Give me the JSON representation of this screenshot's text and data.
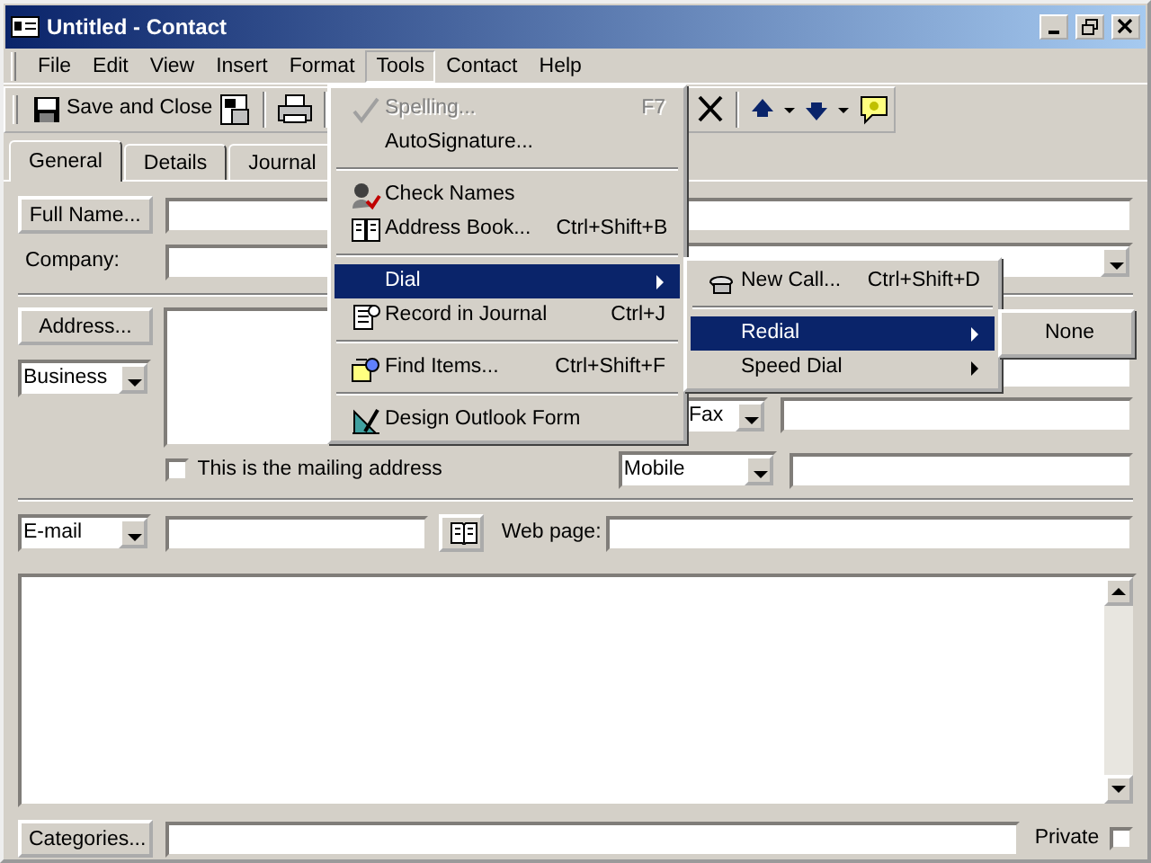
{
  "window": {
    "title": "Untitled - Contact"
  },
  "menu_bar": [
    {
      "label": "File",
      "selected": false
    },
    {
      "label": "Edit",
      "selected": false
    },
    {
      "label": "View",
      "selected": false
    },
    {
      "label": "Insert",
      "selected": false
    },
    {
      "label": "Format",
      "selected": false
    },
    {
      "label": "Tools",
      "selected": true
    },
    {
      "label": "Contact",
      "selected": false
    },
    {
      "label": "Help",
      "selected": false
    }
  ],
  "toolbar": {
    "save_and_close": "Save and Close"
  },
  "tabs": [
    {
      "label": "General",
      "selected": true
    },
    {
      "label": "Details",
      "selected": false
    },
    {
      "label": "Journal",
      "selected": false
    }
  ],
  "form": {
    "full_name_button": "Full Name...",
    "company_label": "Company:",
    "address_button": "Address...",
    "address_type": "Business",
    "mailing_checkbox": {
      "label": "This is the mailing address",
      "checked": false
    },
    "fax_type": "Fax",
    "mobile_type": "Mobile",
    "email_type": "E-mail",
    "web_page_label": "Web page:",
    "categories_button": "Categories...",
    "private_checkbox": {
      "label": "Private",
      "checked": false
    }
  },
  "tools_menu": [
    {
      "kind": "item",
      "label": "Spelling...",
      "shortcut": "F7",
      "disabled": true,
      "selected": false,
      "submenu": false
    },
    {
      "kind": "item",
      "label": "AutoSignature...",
      "disabled": false,
      "selected": false,
      "submenu": false
    },
    {
      "kind": "separator"
    },
    {
      "kind": "item",
      "label": "Check Names",
      "disabled": false,
      "selected": false,
      "submenu": false
    },
    {
      "kind": "item",
      "label": "Address Book...",
      "shortcut": "Ctrl+Shift+B",
      "disabled": false,
      "selected": false,
      "submenu": false
    },
    {
      "kind": "separator"
    },
    {
      "kind": "item",
      "label": "Dial",
      "disabled": false,
      "selected": true,
      "submenu": true
    },
    {
      "kind": "item",
      "label": "Record in Journal",
      "shortcut": "Ctrl+J",
      "disabled": false,
      "selected": false,
      "submenu": false
    },
    {
      "kind": "separator"
    },
    {
      "kind": "item",
      "label": "Find Items...",
      "shortcut": "Ctrl+Shift+F",
      "disabled": false,
      "selected": false,
      "submenu": false
    },
    {
      "kind": "separator"
    },
    {
      "kind": "item",
      "label": "Design Outlook Form",
      "disabled": false,
      "selected": false,
      "submenu": false
    }
  ],
  "dial_submenu": [
    {
      "kind": "item",
      "label": "New Call...",
      "shortcut": "Ctrl+Shift+D",
      "disabled": false,
      "selected": false,
      "submenu": false
    },
    {
      "kind": "separator"
    },
    {
      "kind": "item",
      "label": "Redial",
      "disabled": false,
      "selected": true,
      "submenu": true
    },
    {
      "kind": "item",
      "label": "Speed Dial",
      "disabled": false,
      "selected": false,
      "submenu": true
    }
  ],
  "redial_submenu": [
    {
      "kind": "item",
      "label": "None",
      "disabled": false,
      "selected": false,
      "submenu": false
    }
  ]
}
